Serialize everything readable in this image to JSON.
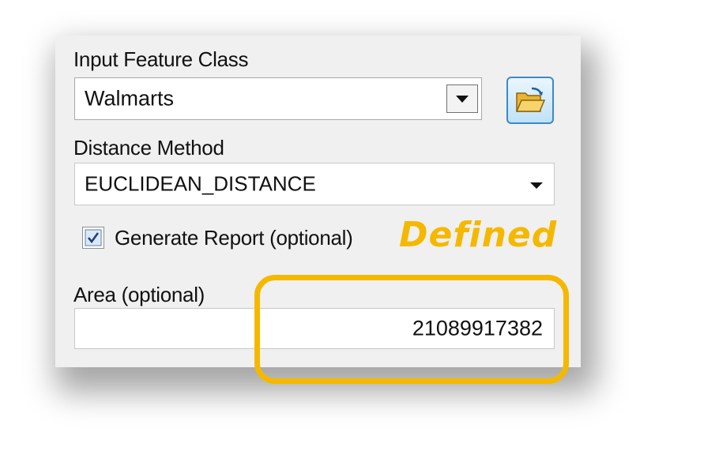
{
  "input_feature_class": {
    "label": "Input Feature Class",
    "value": "Walmarts",
    "browse_icon": "open-folder-icon"
  },
  "distance_method": {
    "label": "Distance Method",
    "value": "EUCLIDEAN_DISTANCE"
  },
  "generate_report": {
    "label": "Generate Report (optional)",
    "checked": true
  },
  "annotation": {
    "text": "Defined",
    "color": "#f5b800"
  },
  "area": {
    "label": "Area (optional)",
    "value": "21089917382"
  }
}
